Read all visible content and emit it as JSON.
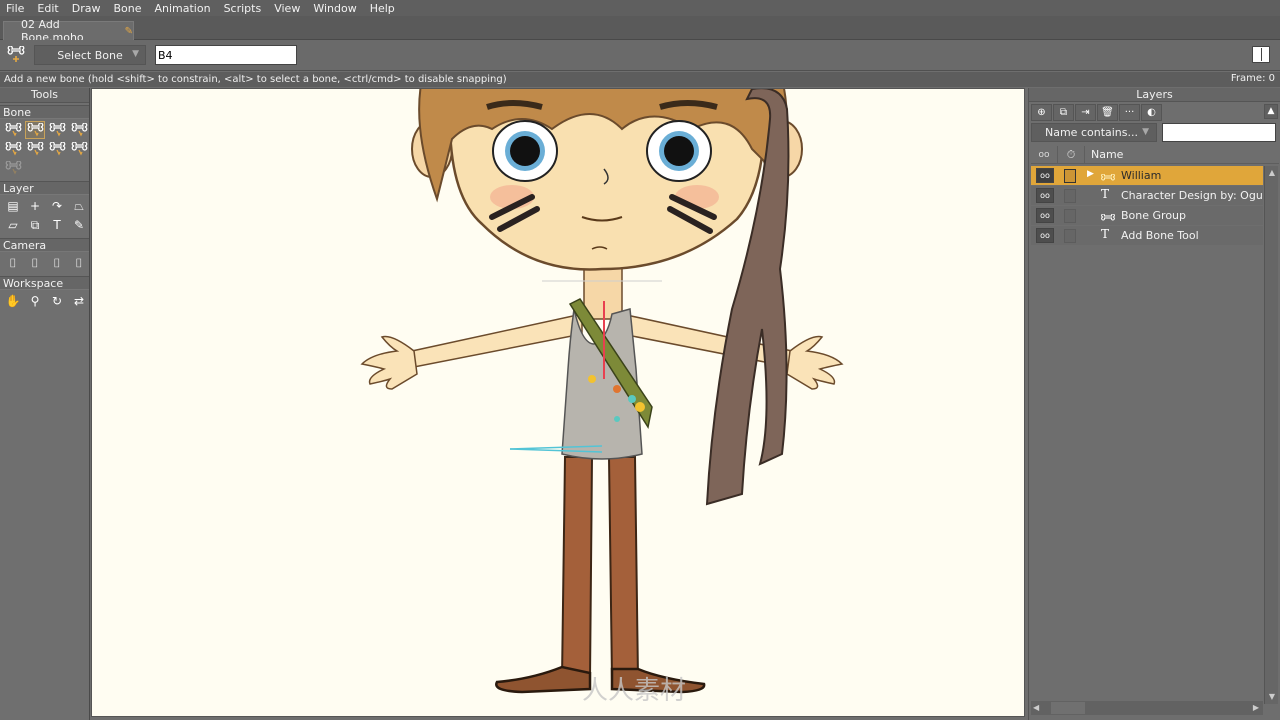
{
  "menu": [
    "File",
    "Edit",
    "Draw",
    "Bone",
    "Animation",
    "Scripts",
    "View",
    "Window",
    "Help"
  ],
  "document_tab": {
    "title": "02 Add Bone.moho",
    "modified_icon": "pencil-icon"
  },
  "tool_options": {
    "tool_icon": "add-bone-icon",
    "select_bone_label": "Select Bone",
    "bone_name_value": "B4",
    "help_icon": "book-icon"
  },
  "status": {
    "message": "Add a new bone (hold <shift> to constrain, <alt> to select a bone, <ctrl/cmd> to disable snapping)",
    "frame_label": "Frame: 0"
  },
  "tools_panel": {
    "title": "Tools",
    "sections": [
      {
        "label": "Bone",
        "tools": [
          {
            "name": "select-bone-tool",
            "glyph": "bone"
          },
          {
            "name": "add-bone-tool",
            "glyph": "bone",
            "active": true
          },
          {
            "name": "reparent-bone-tool",
            "glyph": "bone"
          },
          {
            "name": "bone-strength-tool",
            "glyph": "bone"
          },
          {
            "name": "transform-bone-tool",
            "glyph": "bone"
          },
          {
            "name": "manipulate-bones-tool",
            "glyph": "bone"
          },
          {
            "name": "bind-layer-tool",
            "glyph": "bone"
          },
          {
            "name": "bind-points-tool",
            "glyph": "bone"
          },
          {
            "name": "offset-bone-tool",
            "glyph": "bone",
            "disabled": true
          }
        ]
      },
      {
        "label": "Layer",
        "tools": [
          {
            "name": "transform-layer-tool",
            "glyph": "▤"
          },
          {
            "name": "set-origin-tool",
            "glyph": "+"
          },
          {
            "name": "rotate-layer-tool",
            "glyph": "↷"
          },
          {
            "name": "shear-layer-tool",
            "glyph": "⏢"
          },
          {
            "name": "perspective-layer-tool",
            "glyph": "▱"
          },
          {
            "name": "switch-layer-tool",
            "glyph": "⧉"
          },
          {
            "name": "text-tool",
            "glyph": "T"
          },
          {
            "name": "eyedropper-tool",
            "glyph": "✎"
          }
        ]
      },
      {
        "label": "Camera",
        "tools": [
          {
            "name": "track-camera-tool",
            "glyph": "⌷"
          },
          {
            "name": "zoom-camera-tool",
            "glyph": "⌷"
          },
          {
            "name": "roll-camera-tool",
            "glyph": "⌷"
          },
          {
            "name": "pan-tilt-camera-tool",
            "glyph": "⌷"
          }
        ]
      },
      {
        "label": "Workspace",
        "tools": [
          {
            "name": "pan-tool",
            "glyph": "✋"
          },
          {
            "name": "zoom-tool",
            "glyph": "⚲"
          },
          {
            "name": "rotate-workspace-tool",
            "glyph": "↻"
          },
          {
            "name": "orbit-workspace-tool",
            "glyph": "⇄"
          }
        ]
      }
    ]
  },
  "layers_panel": {
    "title": "Layers",
    "toolbar": [
      {
        "name": "new-layer-button",
        "glyph": "⊕"
      },
      {
        "name": "duplicate-layer-button",
        "glyph": "⧉"
      },
      {
        "name": "import-layer-button",
        "glyph": "⇥"
      },
      {
        "name": "delete-layer-button",
        "glyph": "🗑"
      },
      {
        "name": "layer-settings-button",
        "glyph": "···"
      },
      {
        "name": "layer-options-button",
        "glyph": "◐"
      }
    ],
    "filter_label": "Name contains...",
    "filter_value": "",
    "columns": {
      "visibility": "oo",
      "timer": "⏱",
      "name": "Name"
    },
    "layers": [
      {
        "name": "William",
        "type": "bone",
        "selected": true,
        "expandable": true
      },
      {
        "name": "Character Design by:  Oguzhan",
        "type": "text",
        "selected": false
      },
      {
        "name": "Bone Group",
        "type": "bone",
        "selected": false
      },
      {
        "name": "Add Bone Tool",
        "type": "text",
        "selected": false
      }
    ]
  },
  "canvas": {
    "background": "#fffdf2",
    "subject": "cartoon boy character rig with bones",
    "watermark_text": "人人素材"
  },
  "colors": {
    "accent_selected": "#e0a63a",
    "panel_bg": "#6e6e6e",
    "active_tool_border": "#c8a25a"
  }
}
